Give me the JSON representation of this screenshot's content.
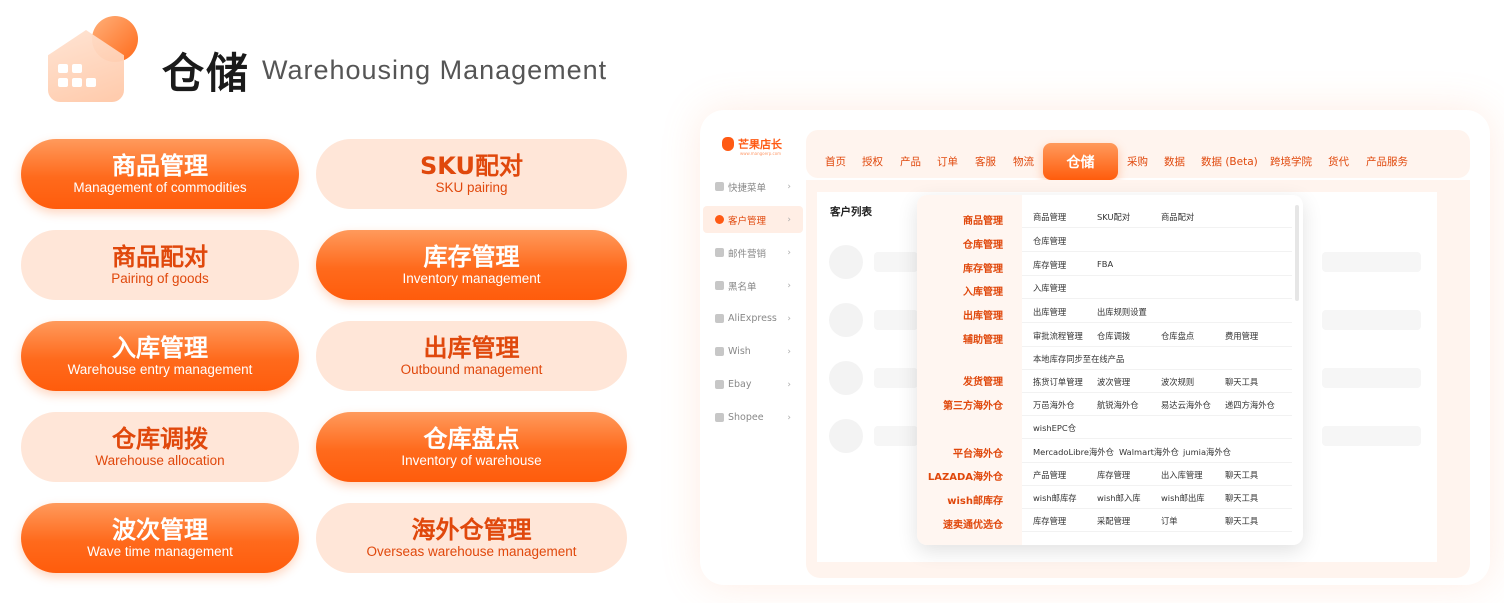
{
  "header": {
    "title_cn": "仓储",
    "title_en": "Warehousing Management"
  },
  "features": [
    {
      "cn": "商品管理",
      "en": "Management of commodities",
      "style": "dark"
    },
    {
      "cn": "SKU配对",
      "en": "SKU pairing",
      "style": "light"
    },
    {
      "cn": "商品配对",
      "en": "Pairing of goods",
      "style": "light"
    },
    {
      "cn": "库存管理",
      "en": "Inventory management",
      "style": "dark"
    },
    {
      "cn": "入库管理",
      "en": "Warehouse entry management",
      "style": "dark"
    },
    {
      "cn": "出库管理",
      "en": "Outbound management",
      "style": "light"
    },
    {
      "cn": "仓库调拨",
      "en": "Warehouse allocation",
      "style": "light"
    },
    {
      "cn": "仓库盘点",
      "en": "Inventory of warehouse",
      "style": "dark"
    },
    {
      "cn": "波次管理",
      "en": "Wave time management",
      "style": "dark"
    },
    {
      "cn": "海外仓管理",
      "en": "Overseas warehouse management",
      "style": "light"
    }
  ],
  "app": {
    "brand": "芒果店长",
    "brand_url": "www.mangoerp.com",
    "sidebar": [
      {
        "label": "快捷菜单",
        "icon": "grid-icon"
      },
      {
        "label": "客户管理",
        "icon": "user-icon",
        "active": true
      },
      {
        "label": "邮件营销",
        "icon": "mail-icon"
      },
      {
        "label": "黑名单",
        "icon": "blacklist-icon"
      },
      {
        "label": "AliExpress",
        "icon": "store-icon"
      },
      {
        "label": "Wish",
        "icon": "store-icon"
      },
      {
        "label": "Ebay",
        "icon": "store-icon"
      },
      {
        "label": "Shopee",
        "icon": "store-icon"
      }
    ],
    "nav": [
      "首页",
      "授权",
      "产品",
      "订单",
      "客服",
      "物流",
      "仓储",
      "采购",
      "数据",
      "数据 (Beta)",
      "跨境学院",
      "货代",
      "产品服务"
    ],
    "content_title": "客户列表",
    "menu": {
      "categories": [
        "商品管理",
        "仓库管理",
        "库存管理",
        "入库管理",
        "出库管理",
        "辅助管理",
        "发货管理",
        "第三方海外仓",
        "平台海外仓",
        "LAZADA海外仓",
        "wish邮库存",
        "速卖通优选仓"
      ],
      "rows": [
        [
          "商品管理",
          "SKU配对",
          "商品配对"
        ],
        [
          "仓库管理"
        ],
        [
          "库存管理",
          "FBA"
        ],
        [
          "入库管理"
        ],
        [
          "出库管理",
          "出库规则设置"
        ],
        [
          "审批流程管理",
          "仓库调拨",
          "仓库盘点",
          "费用管理"
        ],
        [
          "本地库存同步至在线产品"
        ],
        [
          "拣货订单管理",
          "波次管理",
          "波次规则",
          "聊天工具"
        ],
        [
          "万邑海外仓",
          "航锐海外仓",
          "易达云海外仓",
          "递四方海外仓"
        ],
        [
          "wishEPC仓"
        ],
        [
          "MercadoLibre海外仓",
          "Walmart海外仓",
          "jumia海外仓"
        ],
        [
          "产品管理",
          "库存管理",
          "出入库管理",
          "聊天工具"
        ],
        [
          "wish邮库存",
          "wish邮入库",
          "wish邮出库",
          "聊天工具"
        ],
        [
          "库存管理",
          "采配管理",
          "订单",
          "聊天工具"
        ]
      ]
    }
  },
  "colors": {
    "accent": "#ff6a1c",
    "accent_text": "#e0480c",
    "pill_light": "#ffe6d8"
  }
}
